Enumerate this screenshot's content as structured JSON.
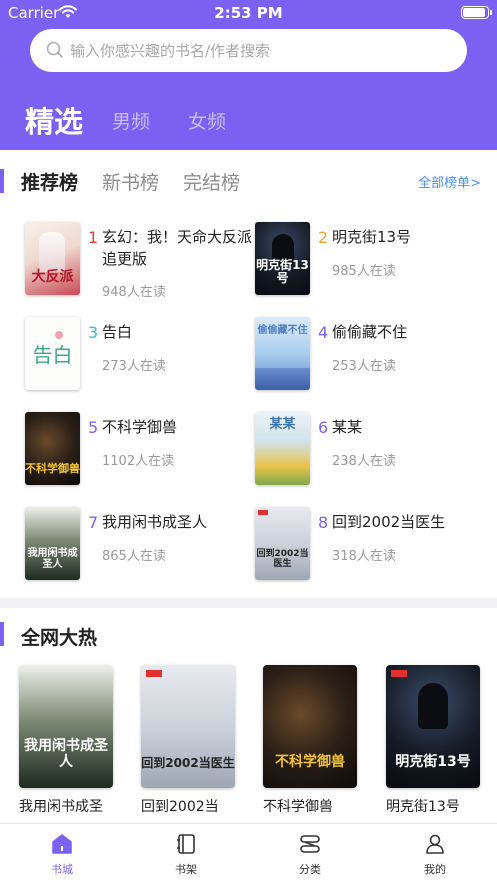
{
  "status": {
    "carrier": "Carrier",
    "time": "2:53 PM"
  },
  "search": {
    "placeholder": "输入你感兴趣的书名/作者搜索"
  },
  "top_tabs": [
    "精选",
    "男频",
    "女频"
  ],
  "rank": {
    "tabs": [
      "推荐榜",
      "新书榜",
      "完结榜"
    ],
    "all_link": "全部榜单>",
    "books": [
      {
        "rank": "1",
        "title": "玄幻：我！天命大反派追更版",
        "readers": "948人在读",
        "rank_color": "#e03c3c",
        "cover_text": "大反派"
      },
      {
        "rank": "2",
        "title": "明克街13号",
        "readers": "985人在读",
        "rank_color": "#f0a030",
        "cover_text": "明克街13号"
      },
      {
        "rank": "3",
        "title": "告白",
        "readers": "273人在读",
        "rank_color": "#34c0d8",
        "cover_text": "告白"
      },
      {
        "rank": "4",
        "title": "偷偷藏不住",
        "readers": "253人在读",
        "rank_color": "#7b61f2",
        "cover_text": "偷偷藏不住"
      },
      {
        "rank": "5",
        "title": "不科学御兽",
        "readers": "1102人在读",
        "rank_color": "#7b61f2",
        "cover_text": "不科学御兽"
      },
      {
        "rank": "6",
        "title": "某某",
        "readers": "238人在读",
        "rank_color": "#7b61f2",
        "cover_text": "某某"
      },
      {
        "rank": "7",
        "title": "我用闲书成圣人",
        "readers": "865人在读",
        "rank_color": "#7b61f2",
        "cover_text": "我用闲书成圣人"
      },
      {
        "rank": "8",
        "title": "回到2002当医生",
        "readers": "318人在读",
        "rank_color": "#7b61f2",
        "cover_text": "回到2002当医生"
      }
    ]
  },
  "hot": {
    "title": "全网大热",
    "books": [
      {
        "name": "我用闲书成圣",
        "cover_text": "我用闲书成圣人"
      },
      {
        "name": "回到2002当",
        "cover_text": "回到2002当医生"
      },
      {
        "name": "不科学御兽",
        "cover_text": "不科学御兽"
      },
      {
        "name": "明克街13号",
        "cover_text": "明克街13号"
      }
    ]
  },
  "tabbar": [
    "书城",
    "书架",
    "分类",
    "我的"
  ],
  "colors": {
    "accent": "#7b61f2",
    "link": "#4a90e2"
  }
}
